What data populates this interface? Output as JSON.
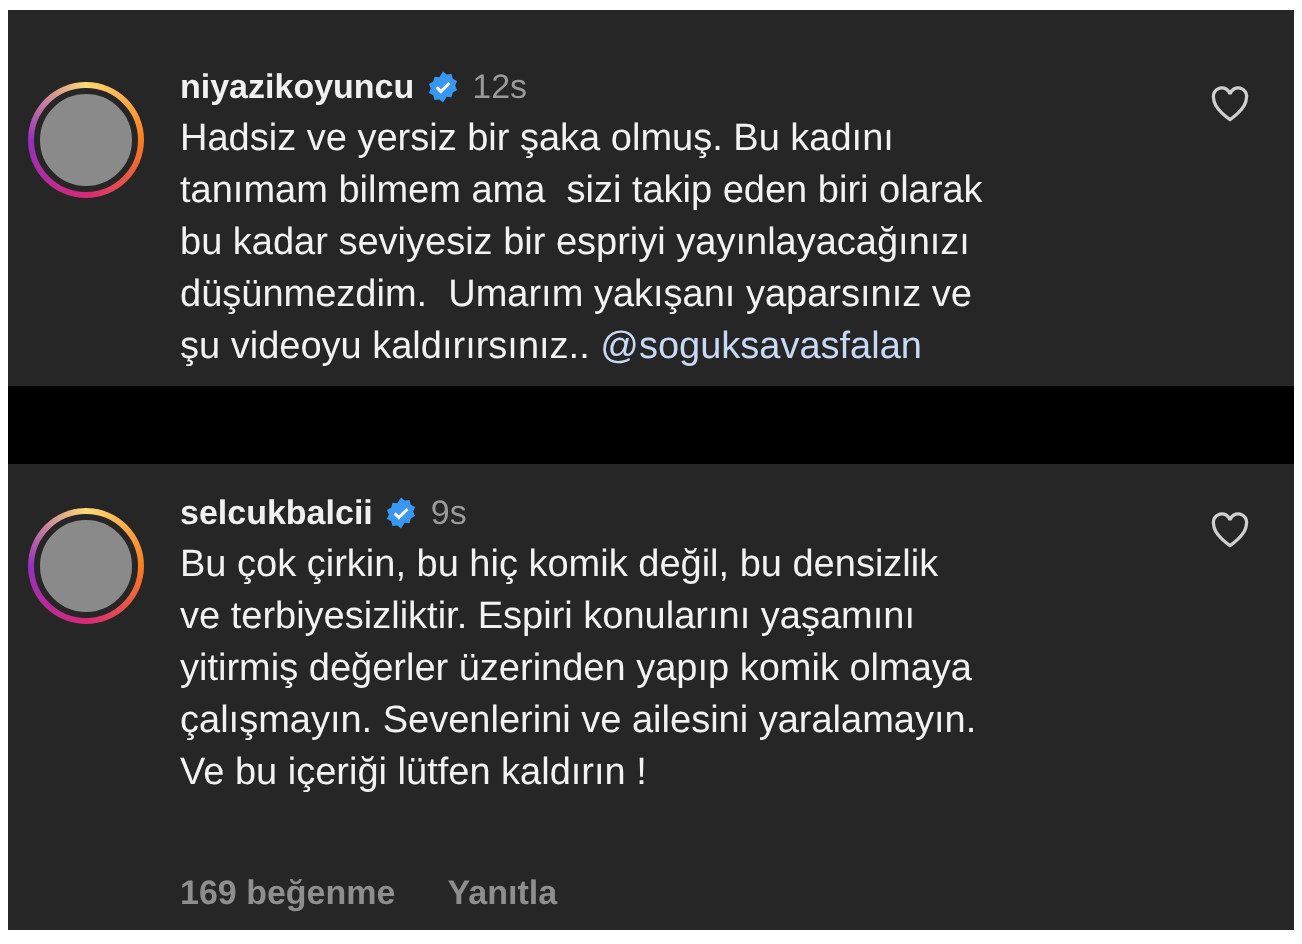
{
  "comments": [
    {
      "username": "niyazikoyuncu",
      "verified": true,
      "time": "12s",
      "text": "Hadsiz ve yersiz bir şaka olmuş. Bu kadını\ntanımam bilmem ama  sizi takip eden biri olarak\nbu kadar seviyesiz bir espriyi yayınlayacağınızı\ndüşünmezdim.  Umarım yakışanı yaparsınız ve\nşu videoyu kaldırırsınız.. ",
      "mention": "@soguksavasfalan",
      "liked": false
    },
    {
      "username": "selcukbalcii",
      "verified": true,
      "time": "9s",
      "text": "Bu çok çirkin, bu hiç komik değil, bu densizlik\nve terbiyesizliktir. Espiri konularını yaşamını\nyitirmiş değerler üzerinden yapıp komik olmaya\nçalışmayın. Sevenlerini ve ailesini yaralamayın.\nVe bu içeriği lütfen kaldırın !",
      "likes": "169 beğenme",
      "reply": "Yanıtla",
      "liked": false
    }
  ]
}
